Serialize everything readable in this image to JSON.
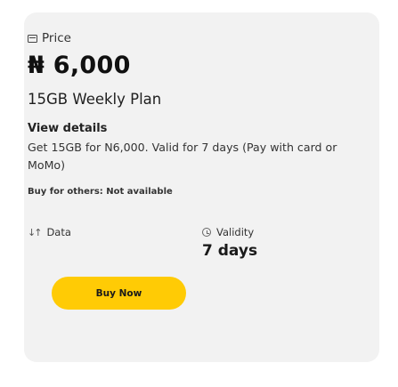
{
  "card": {
    "price_label": "Price",
    "price_value": "₦ 6,000",
    "plan_name": "15GB Weekly Plan",
    "view_details_label": "View details",
    "description": "Get 15GB for N6,000. Valid for 7 days (Pay with card or MoMo)",
    "buy_for_others": "Buy for others: Not available",
    "data_label": "Data",
    "validity_label": "Validity",
    "validity_value": "7 days",
    "buy_button_label": "Buy Now",
    "accent_color": "#ffcb05",
    "icons": {
      "price": "card-icon",
      "data": "up-down-arrows-icon",
      "validity": "clock-icon"
    }
  }
}
